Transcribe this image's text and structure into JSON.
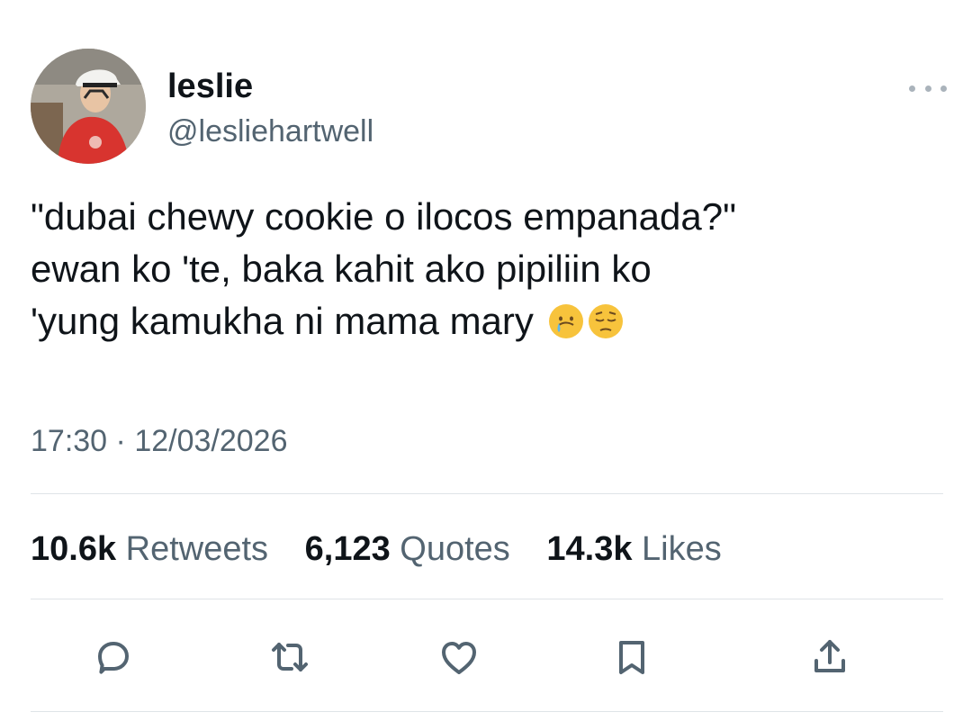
{
  "user": {
    "display_name": "leslie",
    "handle": "@lesliehartwell",
    "avatar_icon": "profile-photo"
  },
  "tweet": {
    "lines": [
      "\"dubai chewy cookie o ilocos empanada?\"",
      "ewan ko 'te, baka kahit ako pipiliin ko",
      "'yung kamukha ni mama mary"
    ],
    "emojis": [
      "crying-face-emoji",
      "pensive-face-emoji"
    ]
  },
  "meta": {
    "time": "17:30",
    "separator": "·",
    "date": "12/03/2026"
  },
  "stats": {
    "retweets": {
      "value": "10.6k",
      "label": "Retweets"
    },
    "quotes": {
      "value": "6,123",
      "label": "Quotes"
    },
    "likes": {
      "value": "14.3k",
      "label": "Likes"
    }
  },
  "actions": [
    "reply-icon",
    "retweet-icon",
    "like-icon",
    "bookmark-icon",
    "share-icon"
  ],
  "colors": {
    "text_primary": "#0f1419",
    "text_secondary": "#536471",
    "divider": "#dfe4e8"
  }
}
